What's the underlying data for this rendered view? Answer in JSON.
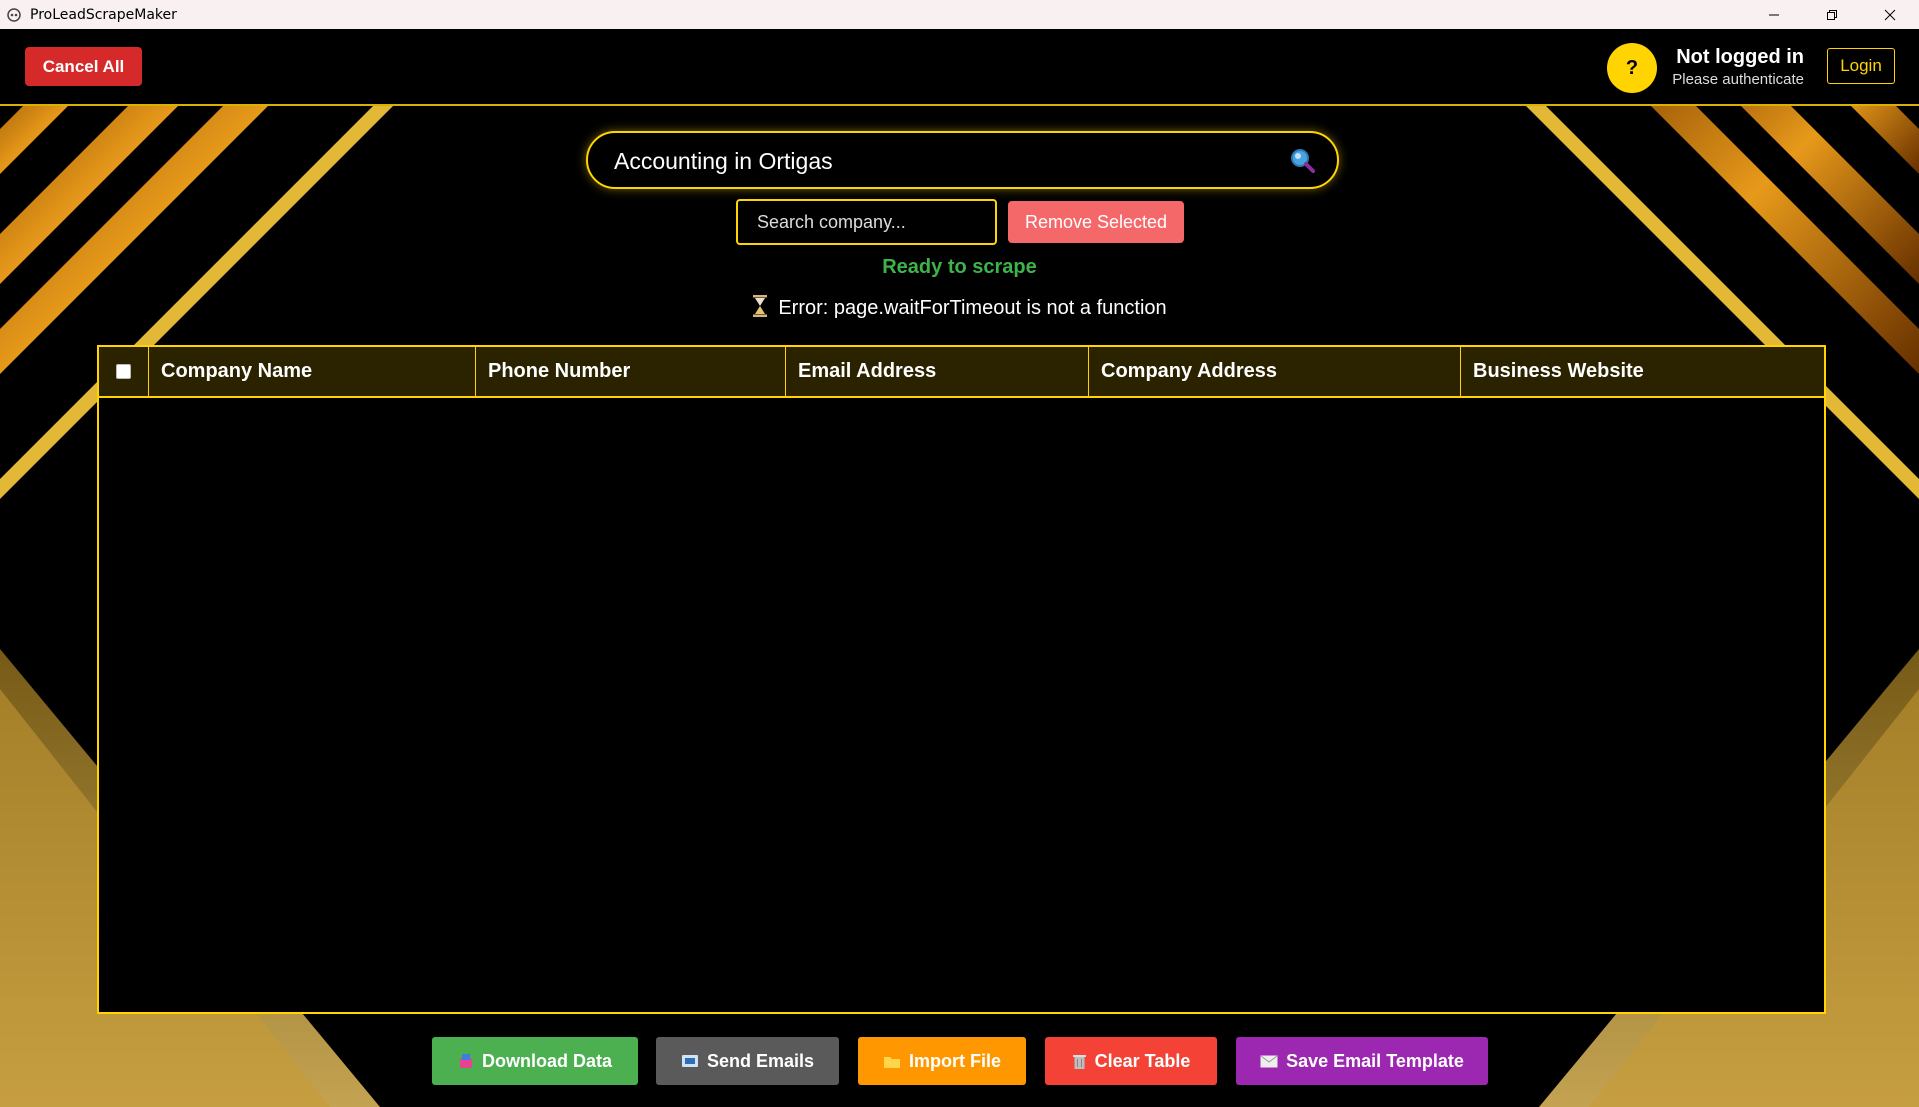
{
  "window": {
    "title": "ProLeadScrapeMaker",
    "controls": [
      "minimize-icon",
      "restore-icon",
      "close-icon"
    ]
  },
  "header": {
    "cancel_label": "Cancel All",
    "help_label": "?",
    "user_status": "Not logged in",
    "user_substatus": "Please authenticate",
    "login_label": "Login"
  },
  "search": {
    "query": "Accounting in Ortigas",
    "company_placeholder": "Search company...",
    "remove_label": "Remove Selected"
  },
  "status": {
    "ready": "Ready to scrape",
    "error": "Error: page.waitForTimeout is not a function"
  },
  "table": {
    "columns": [
      "Company Name",
      "Phone Number",
      "Email Address",
      "Company Address",
      "Business Website"
    ],
    "rows": []
  },
  "footer": {
    "download_label": "Download Data",
    "send_label": "Send Emails",
    "import_label": "Import File",
    "clear_label": "Clear Table",
    "save_template_label": "Save Email Template"
  },
  "colors": {
    "accent": "#ffd400",
    "download": "#4caf50",
    "send": "#5a5a5a",
    "import": "#ff9800",
    "clear": "#f44336",
    "save_template": "#9c27b0",
    "cancel": "#d62a2a",
    "remove": "#f4686a",
    "ready": "#3db34a"
  }
}
